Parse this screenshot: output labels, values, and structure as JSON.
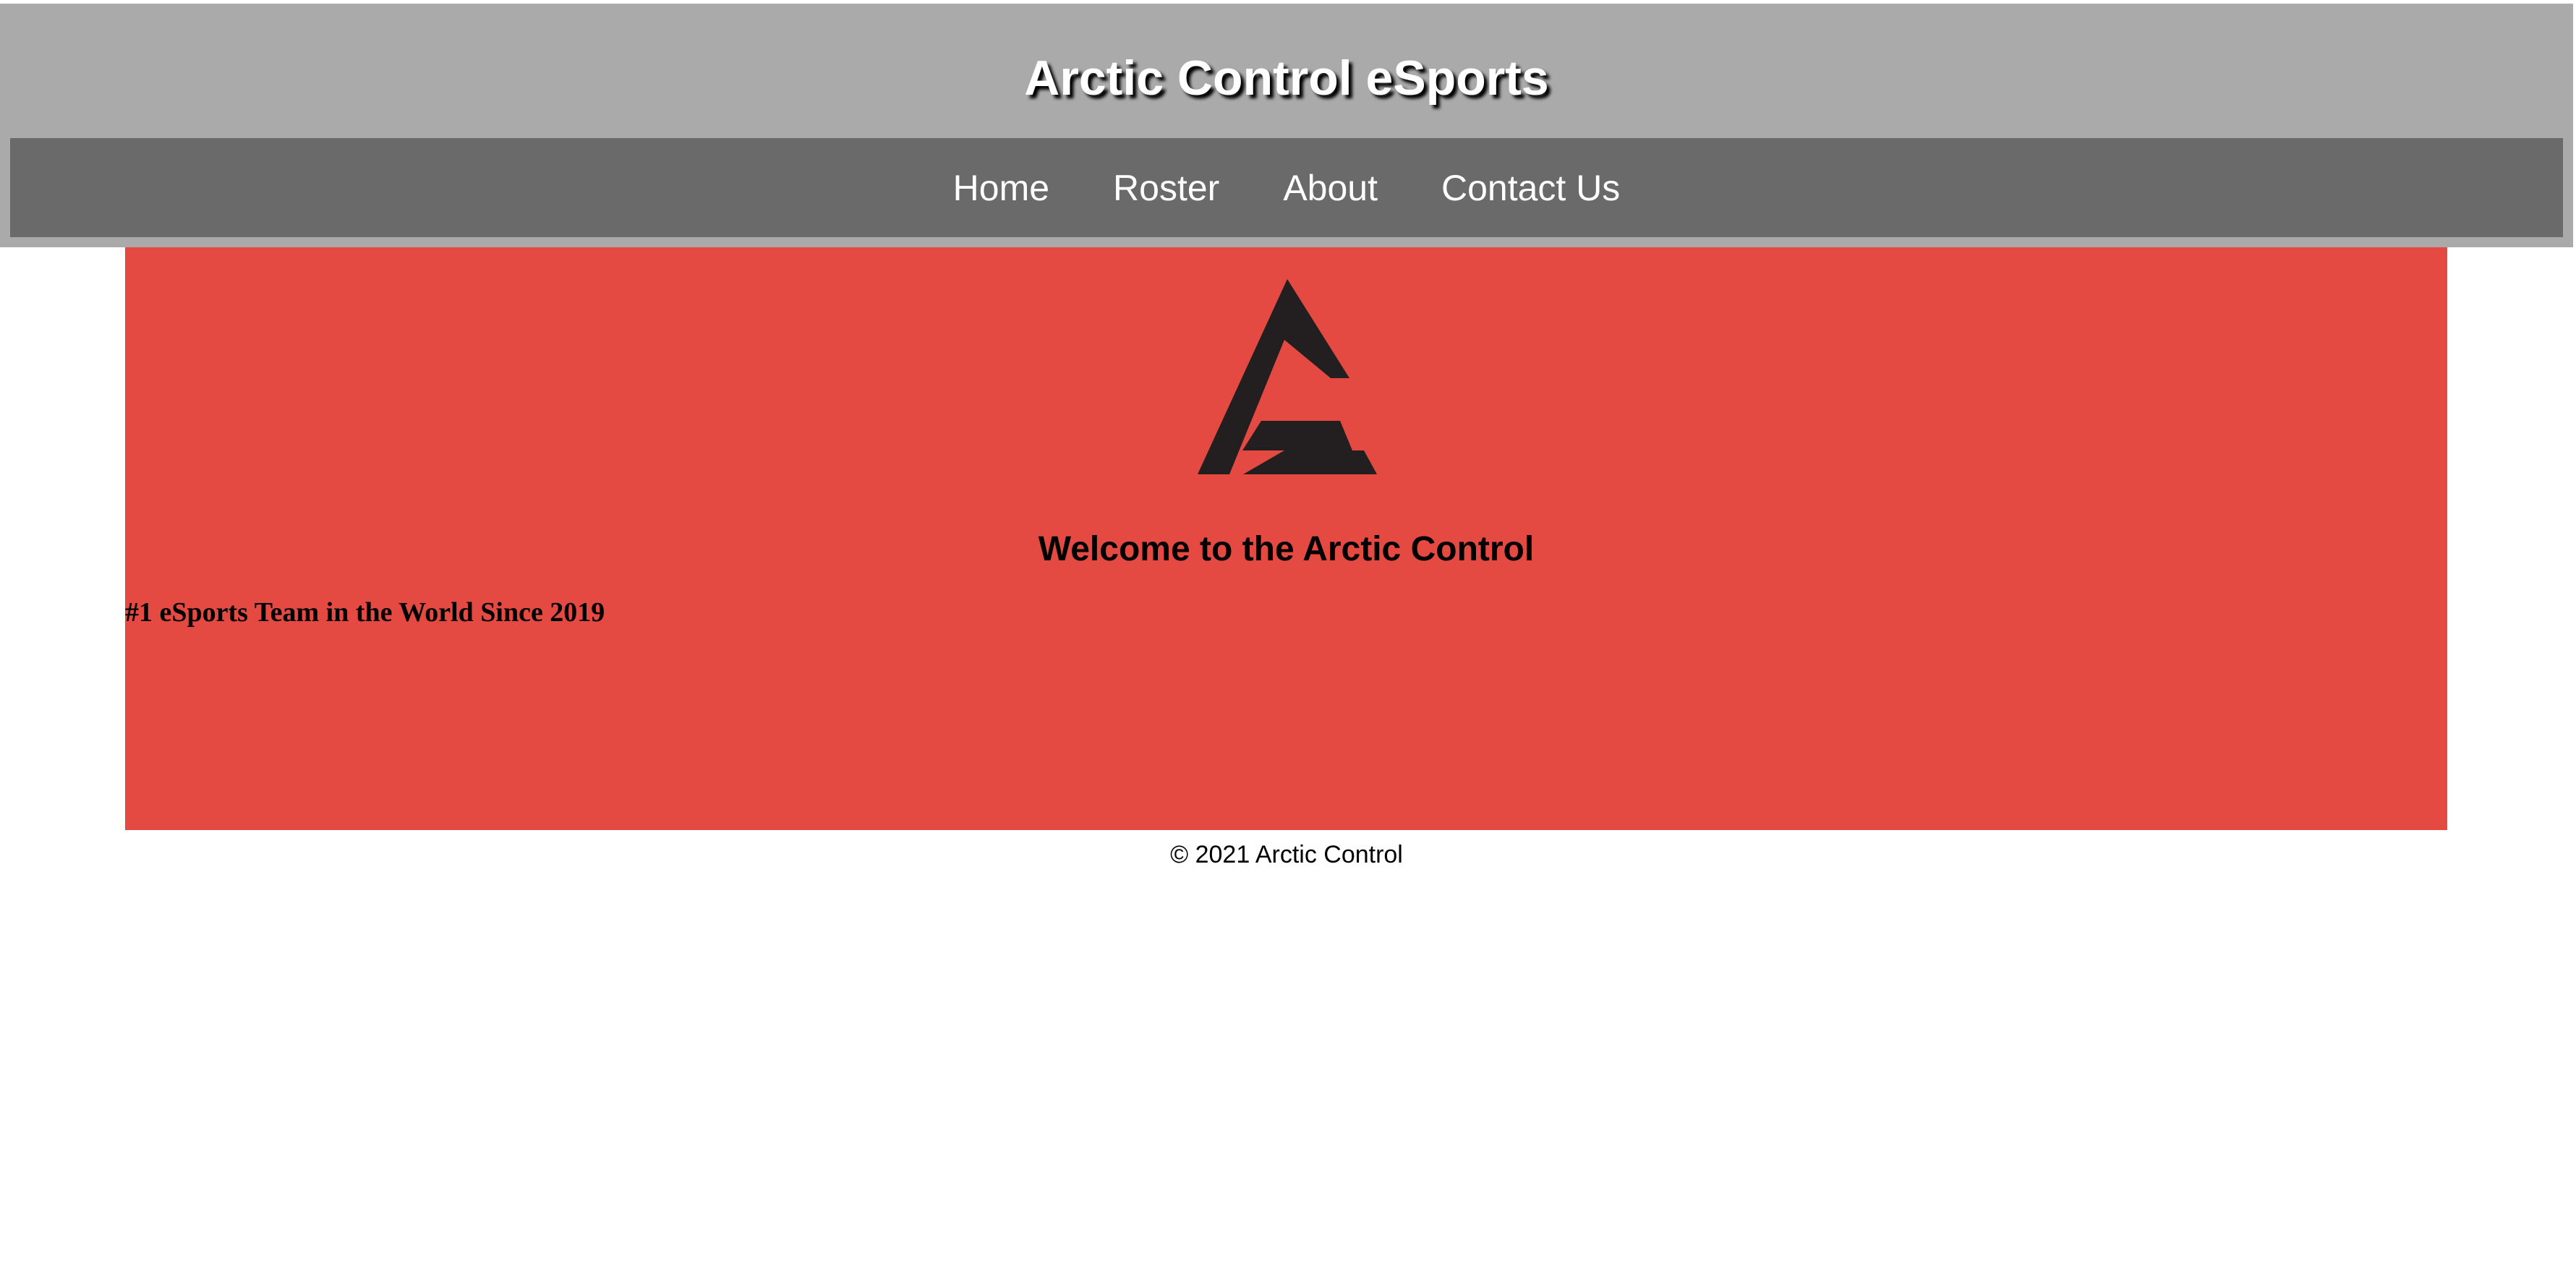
{
  "header": {
    "title": "Arctic Control eSports",
    "background_color": "#aaaaaa"
  },
  "nav": {
    "background_color": "#6a6a6a",
    "items": [
      {
        "label": "Home"
      },
      {
        "label": "Roster"
      },
      {
        "label": "About"
      },
      {
        "label": "Contact Us"
      }
    ]
  },
  "hero": {
    "background_color": "#e44a41",
    "logo_icon": "arctic-control-logo-icon",
    "heading": "Welcome to the Arctic Control",
    "tagline": "#1 eSports Team in the World Since 2019"
  },
  "footer": {
    "copyright": "© 2021 Arctic Control"
  }
}
